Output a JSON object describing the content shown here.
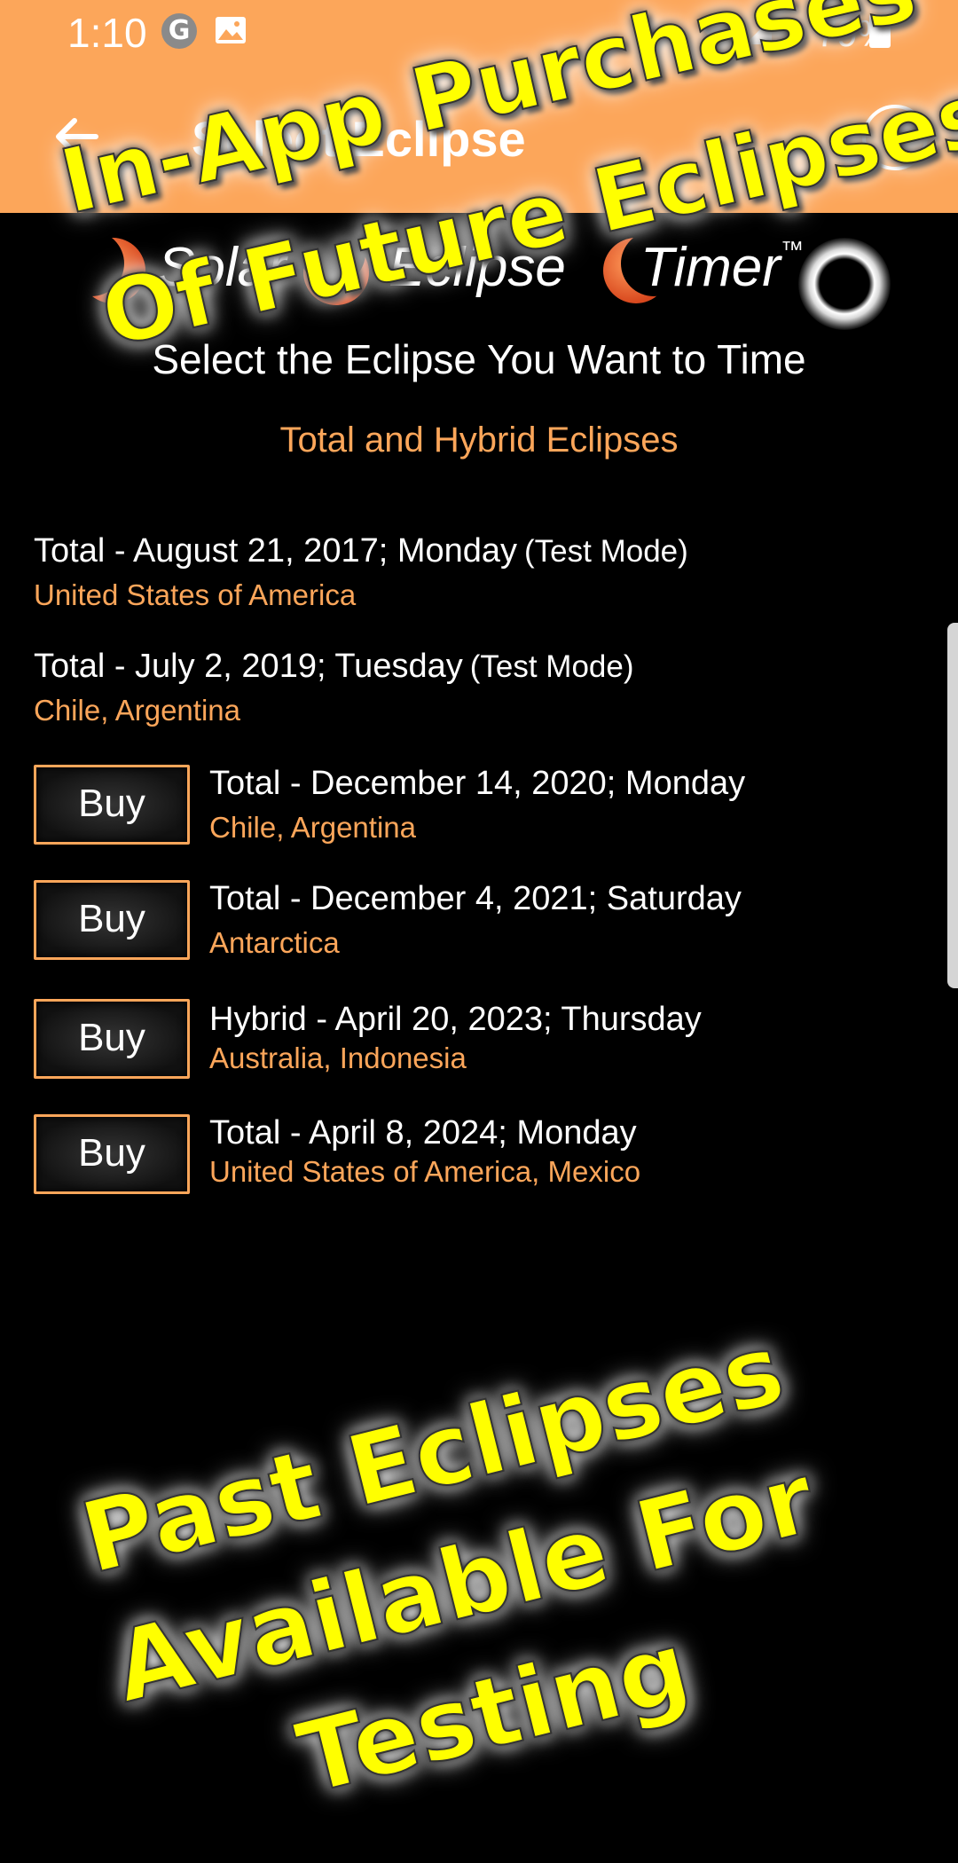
{
  "status_bar": {
    "time": "1:10",
    "battery": "79%",
    "icons": [
      "google-icon",
      "image-icon",
      "wifi-icon",
      "signal-icon",
      "battery-icon"
    ]
  },
  "app_bar": {
    "title": "Select Eclipse",
    "back_icon": "back-arrow-icon",
    "info_icon": "info-icon",
    "info_glyph": "i",
    "background": "#FCA65A"
  },
  "logo": {
    "word1": "Solar",
    "word2": "Eclipse",
    "word3": "Timer",
    "trademark": "™"
  },
  "subtitle": "Select the Eclipse You Want to Time",
  "section_heading": "Total and Hybrid Eclipses",
  "test_mode_label": "(Test Mode)",
  "eclipses": [
    {
      "title": "Total - August 21, 2017; Monday",
      "location": "United States of America",
      "status": "test"
    },
    {
      "title": "Total - July 2, 2019; Tuesday",
      "location": "Chile, Argentina",
      "status": "test"
    },
    {
      "title": "Total - December 14, 2020; Monday",
      "location": "Chile, Argentina",
      "status": "buy",
      "button": "Buy"
    },
    {
      "title": "Total - December 4, 2021; Saturday",
      "location": "Antarctica",
      "status": "buy",
      "button": "Buy"
    },
    {
      "title": "Hybrid - April 20, 2023; Thursday",
      "location": "Australia, Indonesia",
      "status": "buy",
      "button": "Buy"
    },
    {
      "title": "Total - April 8, 2024; Monday",
      "location": "United States of America, Mexico",
      "status": "buy",
      "button": "Buy"
    }
  ],
  "promo": {
    "top_line1": "In-App Purchases",
    "top_line2": "Of Future Eclipses",
    "bottom_line1": "Past Eclipses",
    "bottom_line2": "Available For",
    "bottom_line3": "Testing",
    "color": "#FFFF00"
  },
  "colors": {
    "accent": "#FCA65A",
    "background": "#000000",
    "text": "#FFFFFF"
  }
}
